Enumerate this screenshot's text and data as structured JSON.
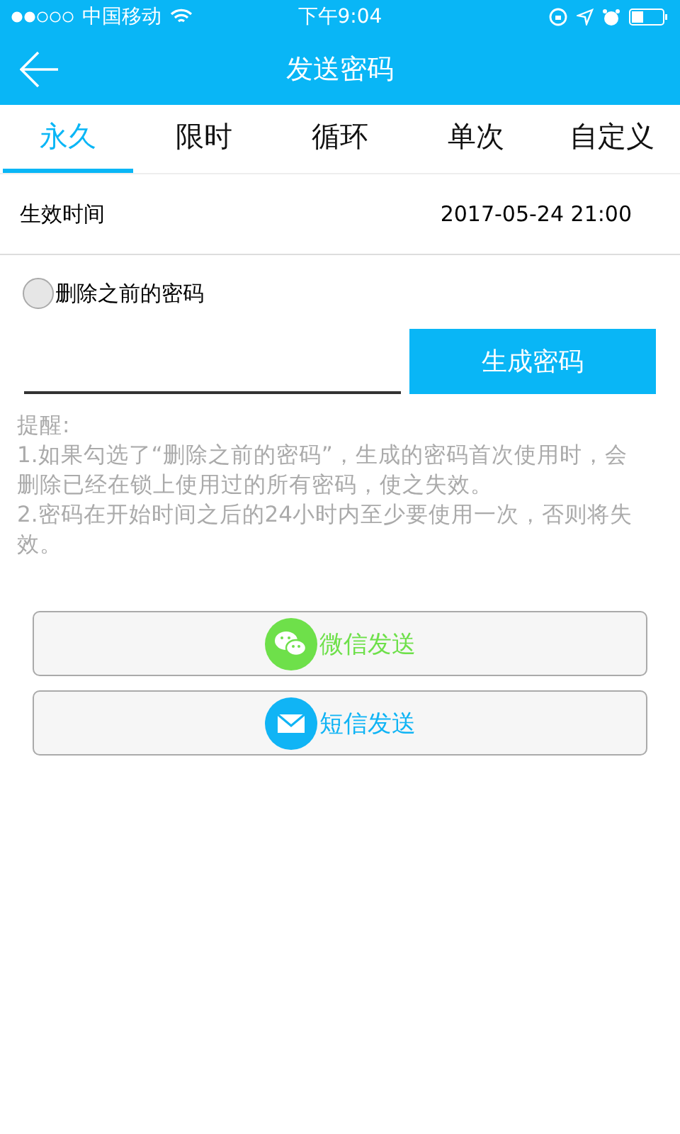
{
  "status_bar": {
    "carrier": "中国移动",
    "time": "下午9:04"
  },
  "header": {
    "title": "发送密码"
  },
  "tabs": [
    {
      "label": "永久",
      "selected": true
    },
    {
      "label": "限时",
      "selected": false
    },
    {
      "label": "循环",
      "selected": false
    },
    {
      "label": "单次",
      "selected": false
    },
    {
      "label": "自定义",
      "selected": false
    }
  ],
  "effective_time": {
    "label": "生效时间",
    "value": "2017-05-24 21:00"
  },
  "delete_previous": {
    "label": "删除之前的密码",
    "checked": false
  },
  "generate_button": "生成密码",
  "notes": [
    "提醒:",
    "1.如果勾选了“删除之前的密码”，生成的密码首次使用时，会删除已经在锁上使用过的所有密码，使之失效。",
    "2.密码在开始时间之后的24小时内至少要使用一次，否则将失效。"
  ],
  "share_buttons": [
    {
      "kind": "wechat",
      "label": "微信发送",
      "color": "#6ee04a"
    },
    {
      "kind": "sms",
      "label": "短信发送",
      "color": "#10b4f5"
    }
  ]
}
